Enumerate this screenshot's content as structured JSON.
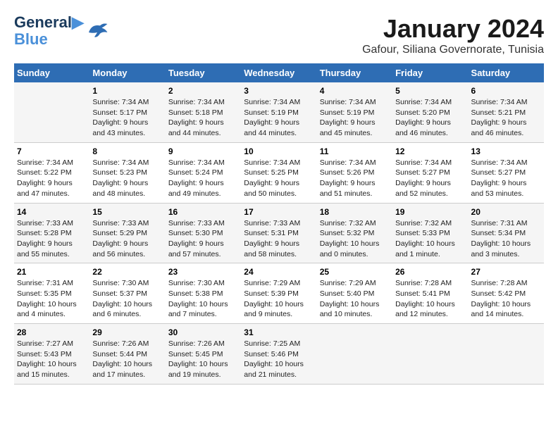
{
  "header": {
    "logo_line1": "General",
    "logo_line2": "Blue",
    "main_title": "January 2024",
    "subtitle": "Gafour, Siliana Governorate, Tunisia"
  },
  "calendar": {
    "days_of_week": [
      "Sunday",
      "Monday",
      "Tuesday",
      "Wednesday",
      "Thursday",
      "Friday",
      "Saturday"
    ],
    "weeks": [
      [
        {
          "day": "",
          "info": ""
        },
        {
          "day": "1",
          "info": "Sunrise: 7:34 AM\nSunset: 5:17 PM\nDaylight: 9 hours\nand 43 minutes."
        },
        {
          "day": "2",
          "info": "Sunrise: 7:34 AM\nSunset: 5:18 PM\nDaylight: 9 hours\nand 44 minutes."
        },
        {
          "day": "3",
          "info": "Sunrise: 7:34 AM\nSunset: 5:19 PM\nDaylight: 9 hours\nand 44 minutes."
        },
        {
          "day": "4",
          "info": "Sunrise: 7:34 AM\nSunset: 5:19 PM\nDaylight: 9 hours\nand 45 minutes."
        },
        {
          "day": "5",
          "info": "Sunrise: 7:34 AM\nSunset: 5:20 PM\nDaylight: 9 hours\nand 46 minutes."
        },
        {
          "day": "6",
          "info": "Sunrise: 7:34 AM\nSunset: 5:21 PM\nDaylight: 9 hours\nand 46 minutes."
        }
      ],
      [
        {
          "day": "7",
          "info": "Sunrise: 7:34 AM\nSunset: 5:22 PM\nDaylight: 9 hours\nand 47 minutes."
        },
        {
          "day": "8",
          "info": "Sunrise: 7:34 AM\nSunset: 5:23 PM\nDaylight: 9 hours\nand 48 minutes."
        },
        {
          "day": "9",
          "info": "Sunrise: 7:34 AM\nSunset: 5:24 PM\nDaylight: 9 hours\nand 49 minutes."
        },
        {
          "day": "10",
          "info": "Sunrise: 7:34 AM\nSunset: 5:25 PM\nDaylight: 9 hours\nand 50 minutes."
        },
        {
          "day": "11",
          "info": "Sunrise: 7:34 AM\nSunset: 5:26 PM\nDaylight: 9 hours\nand 51 minutes."
        },
        {
          "day": "12",
          "info": "Sunrise: 7:34 AM\nSunset: 5:27 PM\nDaylight: 9 hours\nand 52 minutes."
        },
        {
          "day": "13",
          "info": "Sunrise: 7:34 AM\nSunset: 5:27 PM\nDaylight: 9 hours\nand 53 minutes."
        }
      ],
      [
        {
          "day": "14",
          "info": "Sunrise: 7:33 AM\nSunset: 5:28 PM\nDaylight: 9 hours\nand 55 minutes."
        },
        {
          "day": "15",
          "info": "Sunrise: 7:33 AM\nSunset: 5:29 PM\nDaylight: 9 hours\nand 56 minutes."
        },
        {
          "day": "16",
          "info": "Sunrise: 7:33 AM\nSunset: 5:30 PM\nDaylight: 9 hours\nand 57 minutes."
        },
        {
          "day": "17",
          "info": "Sunrise: 7:33 AM\nSunset: 5:31 PM\nDaylight: 9 hours\nand 58 minutes."
        },
        {
          "day": "18",
          "info": "Sunrise: 7:32 AM\nSunset: 5:32 PM\nDaylight: 10 hours\nand 0 minutes."
        },
        {
          "day": "19",
          "info": "Sunrise: 7:32 AM\nSunset: 5:33 PM\nDaylight: 10 hours\nand 1 minute."
        },
        {
          "day": "20",
          "info": "Sunrise: 7:31 AM\nSunset: 5:34 PM\nDaylight: 10 hours\nand 3 minutes."
        }
      ],
      [
        {
          "day": "21",
          "info": "Sunrise: 7:31 AM\nSunset: 5:35 PM\nDaylight: 10 hours\nand 4 minutes."
        },
        {
          "day": "22",
          "info": "Sunrise: 7:30 AM\nSunset: 5:37 PM\nDaylight: 10 hours\nand 6 minutes."
        },
        {
          "day": "23",
          "info": "Sunrise: 7:30 AM\nSunset: 5:38 PM\nDaylight: 10 hours\nand 7 minutes."
        },
        {
          "day": "24",
          "info": "Sunrise: 7:29 AM\nSunset: 5:39 PM\nDaylight: 10 hours\nand 9 minutes."
        },
        {
          "day": "25",
          "info": "Sunrise: 7:29 AM\nSunset: 5:40 PM\nDaylight: 10 hours\nand 10 minutes."
        },
        {
          "day": "26",
          "info": "Sunrise: 7:28 AM\nSunset: 5:41 PM\nDaylight: 10 hours\nand 12 minutes."
        },
        {
          "day": "27",
          "info": "Sunrise: 7:28 AM\nSunset: 5:42 PM\nDaylight: 10 hours\nand 14 minutes."
        }
      ],
      [
        {
          "day": "28",
          "info": "Sunrise: 7:27 AM\nSunset: 5:43 PM\nDaylight: 10 hours\nand 15 minutes."
        },
        {
          "day": "29",
          "info": "Sunrise: 7:26 AM\nSunset: 5:44 PM\nDaylight: 10 hours\nand 17 minutes."
        },
        {
          "day": "30",
          "info": "Sunrise: 7:26 AM\nSunset: 5:45 PM\nDaylight: 10 hours\nand 19 minutes."
        },
        {
          "day": "31",
          "info": "Sunrise: 7:25 AM\nSunset: 5:46 PM\nDaylight: 10 hours\nand 21 minutes."
        },
        {
          "day": "",
          "info": ""
        },
        {
          "day": "",
          "info": ""
        },
        {
          "day": "",
          "info": ""
        }
      ]
    ]
  }
}
